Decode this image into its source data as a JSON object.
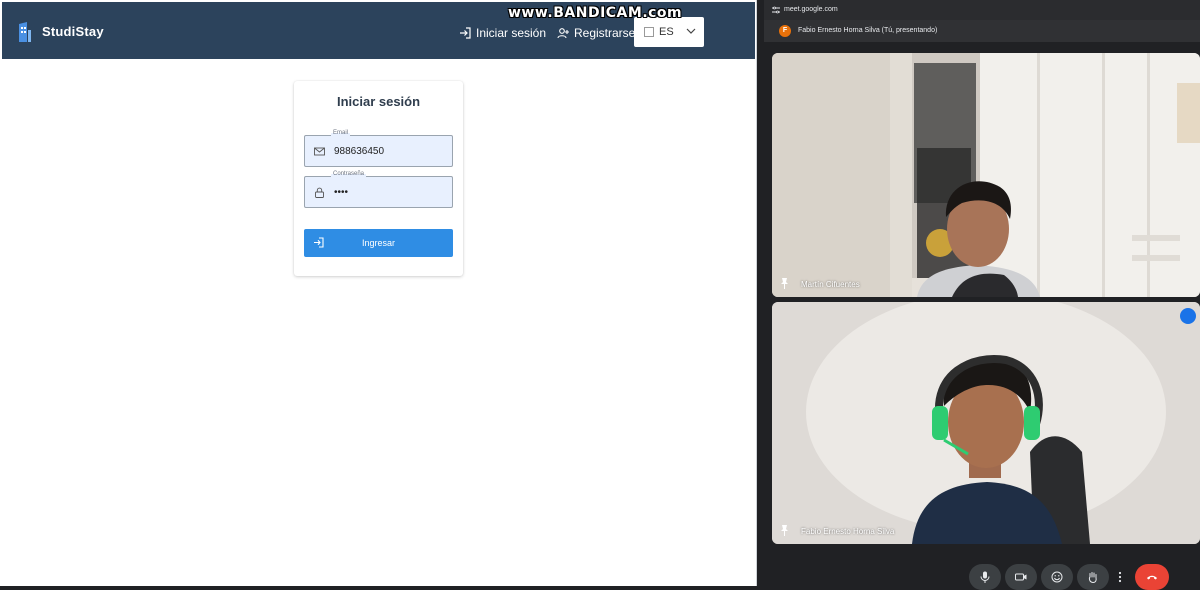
{
  "app": {
    "brand": "StudiStay",
    "nav": {
      "login": "Iniciar sesión",
      "register": "Registrarse"
    },
    "language": {
      "selected": "ES"
    }
  },
  "watermark": "www.BANDICAM.com",
  "login_form": {
    "title": "Iniciar sesión",
    "email": {
      "label": "Email",
      "value": "988636450"
    },
    "password": {
      "label": "Contraseña",
      "value": "••••"
    },
    "submit_label": "Ingresar"
  },
  "meet": {
    "url": "meet.google.com",
    "presenter_initial": "F",
    "presenter_text": "Fabio Ernesto Horna Silva (Tú, presentando)",
    "participants": [
      {
        "name": "Martín Cifuentes"
      },
      {
        "name": "Fabio Ernesto Horna Silva"
      }
    ]
  },
  "colors": {
    "navbar": "#2c435c",
    "primary_button": "#2f8de4",
    "input_fill": "#e8f0fe",
    "meet_bg": "#202124",
    "end_call": "#ea4335",
    "presenter_avatar": "#e8710a"
  }
}
